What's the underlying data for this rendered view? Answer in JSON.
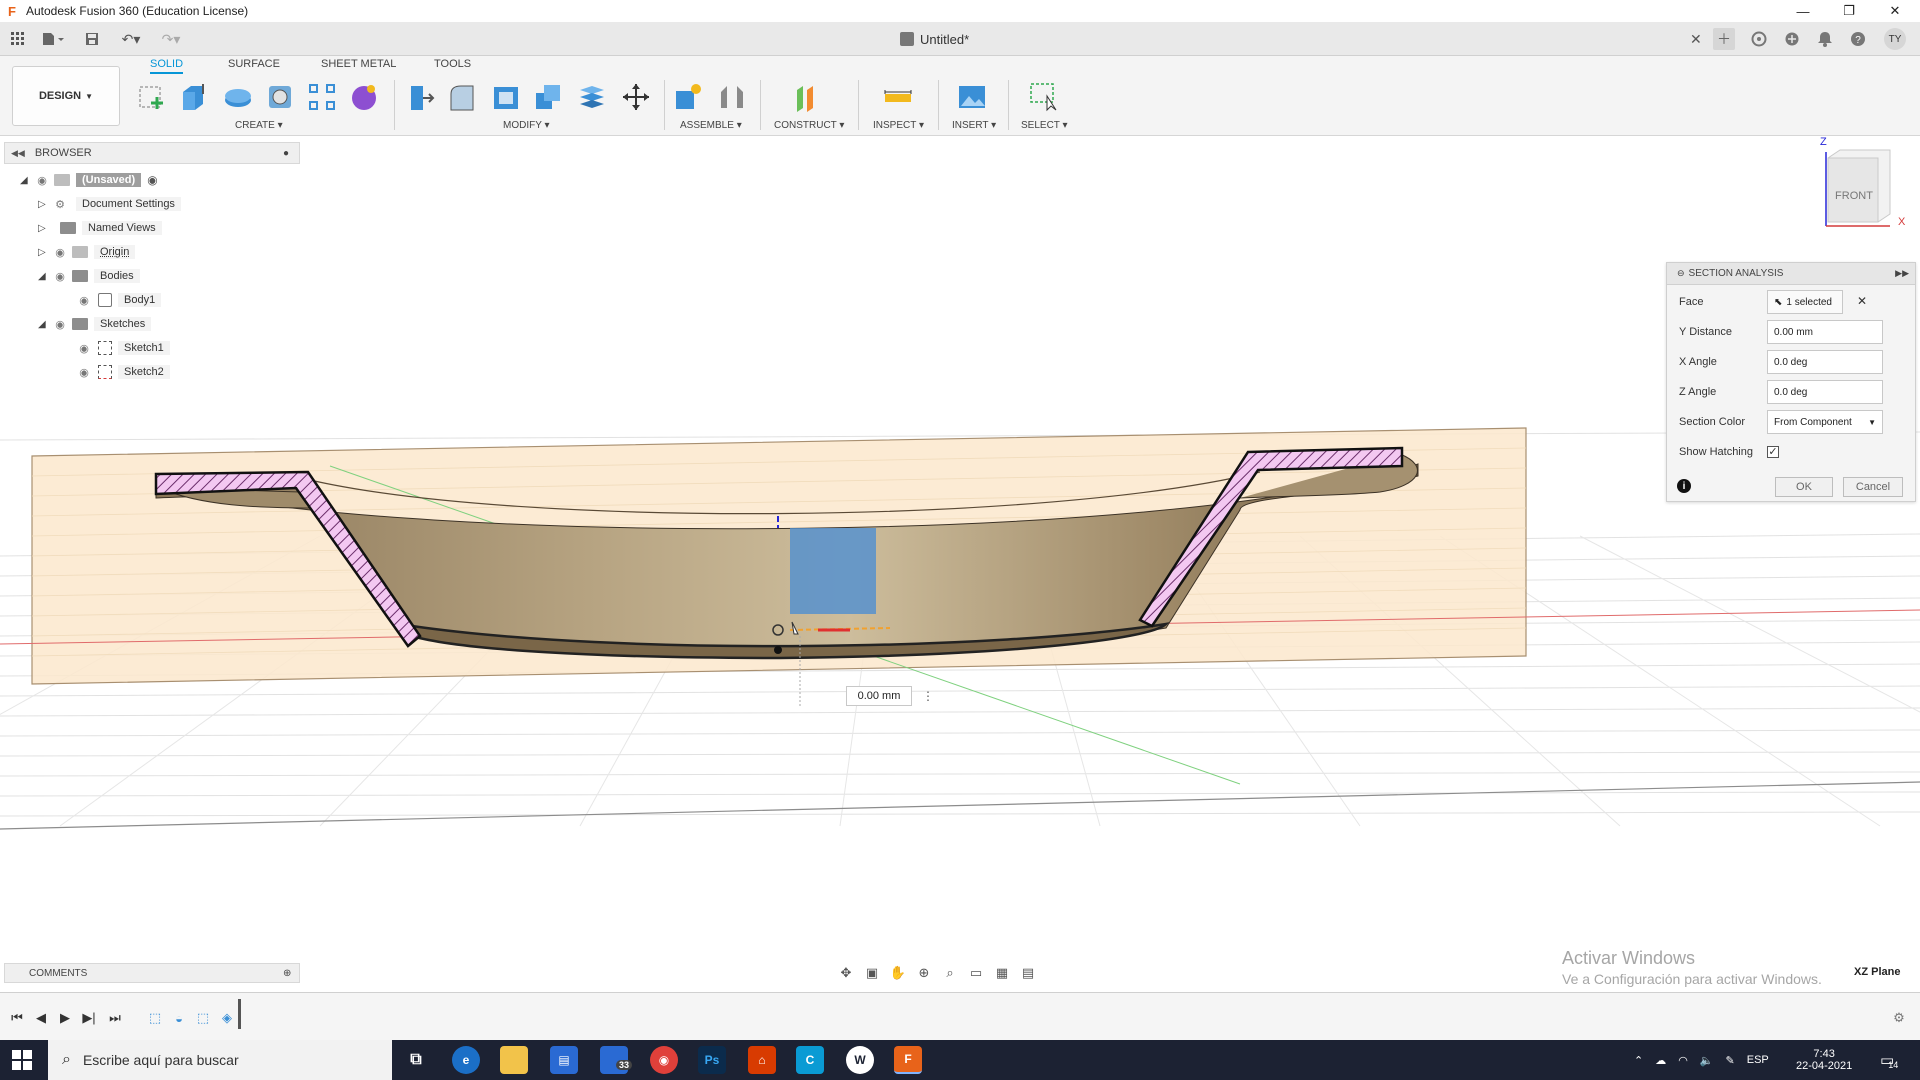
{
  "window": {
    "title": "Autodesk Fusion 360 (Education License)",
    "minimize": "—",
    "maximize": "❐",
    "close": "✕"
  },
  "document": {
    "title": "Untitled*",
    "close": "✕",
    "user_initials": "TY"
  },
  "ribbon": {
    "tabs": [
      "SOLID",
      "SURFACE",
      "SHEET METAL",
      "TOOLS"
    ],
    "active_tab": "SOLID",
    "workspace": "DESIGN",
    "groups": [
      "CREATE",
      "MODIFY",
      "ASSEMBLE",
      "CONSTRUCT",
      "INSPECT",
      "INSERT",
      "SELECT"
    ]
  },
  "browser": {
    "title": "BROWSER",
    "items": [
      {
        "label": "(Unsaved)"
      },
      {
        "label": "Document Settings"
      },
      {
        "label": "Named Views"
      },
      {
        "label": "Origin"
      },
      {
        "label": "Bodies"
      },
      {
        "label": "Body1"
      },
      {
        "label": "Sketches"
      },
      {
        "label": "Sketch1"
      },
      {
        "label": "Sketch2"
      }
    ]
  },
  "viewcube": {
    "face": "FRONT",
    "axis_z": "Z",
    "axis_x": "X"
  },
  "section_analysis": {
    "title": "SECTION ANALYSIS",
    "face_label": "Face",
    "face_value": "1 selected",
    "y_distance_label": "Y Distance",
    "y_distance_value": "0.00 mm",
    "x_angle_label": "X Angle",
    "x_angle_value": "0.0 deg",
    "z_angle_label": "Z Angle",
    "z_angle_value": "0.0 deg",
    "section_color_label": "Section Color",
    "section_color_value": "From Component",
    "show_hatching_label": "Show Hatching",
    "show_hatching_checked": true,
    "ok": "OK",
    "cancel": "Cancel"
  },
  "canvas": {
    "distance_readout": "0.00 mm"
  },
  "comments": {
    "label": "COMMENTS"
  },
  "watermark": {
    "line1": "Activar Windows",
    "line2": "Ve a Configuración para activar Windows."
  },
  "status": {
    "plane": "XZ Plane"
  },
  "taskbar": {
    "search_placeholder": "Escribe aquí para buscar",
    "mail_badge": "33",
    "language": "ESP",
    "time": "7:43",
    "date": "22-04-2021",
    "notifications": "14"
  },
  "colors": {
    "accent": "#0696d7",
    "section_fill": "#fbe8cc",
    "hatch": "#e9a4e8",
    "body": "#9a8262"
  }
}
